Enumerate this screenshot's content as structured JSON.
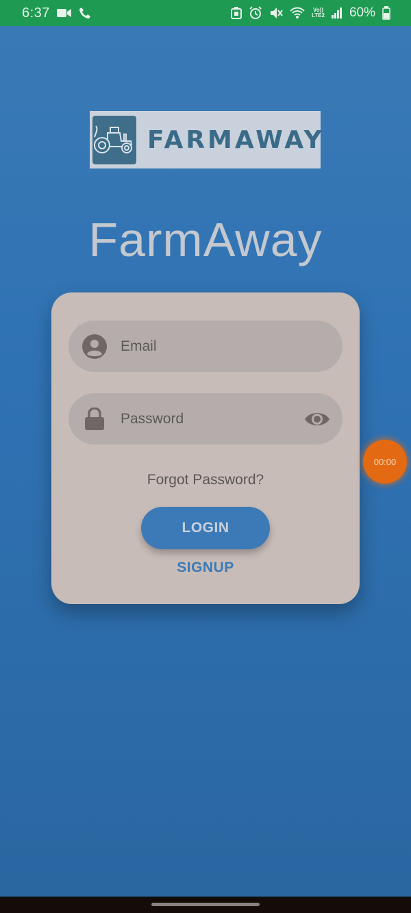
{
  "status_bar": {
    "time": "6:37",
    "network_top": "Vo))",
    "network_bottom": "LTE2",
    "battery": "60%",
    "icons": [
      "video-call-icon",
      "phone-icon",
      "nfc-icon",
      "alarm-icon",
      "mute-icon",
      "wifi-icon",
      "signal-icon",
      "battery-icon"
    ]
  },
  "logo": {
    "text": "FARMAWAY",
    "icon": "tractor-icon"
  },
  "app_title": "FarmAway",
  "login_form": {
    "email_placeholder": "Email",
    "password_placeholder": "Password",
    "forgot_password": "Forgot Password?",
    "login_button": "LOGIN",
    "signup_link": "SIGNUP"
  },
  "timer": "00:00",
  "colors": {
    "status_bar": "#1e9a52",
    "background": "#2f72b4",
    "card": "#c8bcb8",
    "input": "#b5adab",
    "accent": "#3b7ab6",
    "timer": "#e36a12"
  }
}
